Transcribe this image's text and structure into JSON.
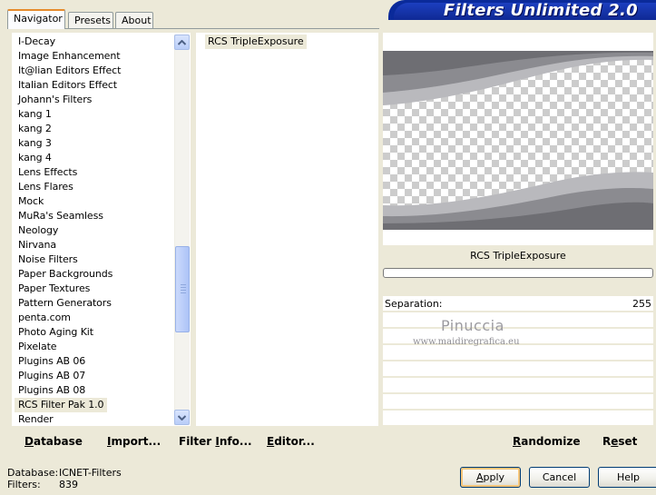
{
  "tabs": [
    {
      "label": "Navigator",
      "active": true
    },
    {
      "label": "Presets",
      "active": false
    },
    {
      "label": "About",
      "active": false
    }
  ],
  "banner": {
    "title": "Filters Unlimited 2.0"
  },
  "categories": [
    "I-Decay",
    "Image Enhancement",
    "It@lian Editors Effect",
    "Italian Editors Effect",
    "Johann's Filters",
    "kang 1",
    "kang 2",
    "kang 3",
    "kang 4",
    "Lens Effects",
    "Lens Flares",
    "Mock",
    "MuRa's Seamless",
    "Neology",
    "Nirvana",
    "Noise Filters",
    "Paper Backgrounds",
    "Paper Textures",
    "Pattern Generators",
    "penta.com",
    "Photo Aging Kit",
    "Pixelate",
    "Plugins AB 06",
    "Plugins AB 07",
    "Plugins AB 08",
    "RCS Filter Pak 1.0",
    "Render"
  ],
  "selected_category": "RCS Filter Pak 1.0",
  "filters": [
    "RCS TripleExposure"
  ],
  "filter_name": "RCS TripleExposure",
  "params": [
    {
      "label": "Separation:",
      "value": "255"
    }
  ],
  "watermark": {
    "name": "Pinuccia",
    "site": "www.maidiregrafica.eu"
  },
  "left_menu": {
    "database": {
      "pre": "",
      "u": "D",
      "post": "atabase"
    },
    "import": {
      "pre": "",
      "u": "I",
      "post": "mport..."
    },
    "filter_info": {
      "pre": "Filter ",
      "u": "I",
      "post": "nfo..."
    },
    "editor": {
      "pre": "",
      "u": "E",
      "post": "ditor..."
    }
  },
  "right_menu": {
    "randomize": {
      "pre": "",
      "u": "R",
      "post": "andomize"
    },
    "reset": {
      "pre": "R",
      "u": "e",
      "post": "set"
    }
  },
  "info": {
    "database_label": "Database:",
    "database_value": "ICNET-Filters",
    "filters_label": "Filters:",
    "filters_value": "839"
  },
  "buttons": {
    "apply": {
      "pre": "",
      "u": "A",
      "post": "pply"
    },
    "cancel": "Cancel",
    "help": "Help"
  },
  "colors": {
    "dialog_bg": "#ece9d8",
    "banner_blue": "#0e2790",
    "scroll_blue": "#bccffa",
    "tab_accent": "#e68b2c"
  }
}
